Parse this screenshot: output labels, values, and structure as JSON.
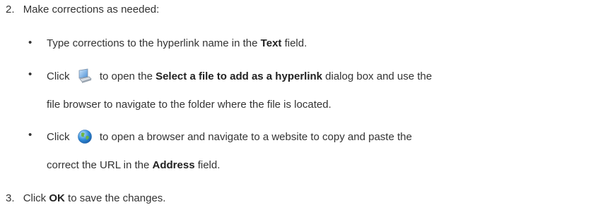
{
  "step2": {
    "number": "2.",
    "text": "Make corrections as needed:"
  },
  "bullets": [
    {
      "pre": "Type corrections to the hyperlink name in the ",
      "bold": "Text",
      "post": " field."
    },
    {
      "pre": "Click",
      "icon": "computer-icon",
      "mid": "to open the ",
      "bold": "Select a file to add as a hyperlink",
      "post": " dialog box and use the",
      "cont": "file browser to navigate to the folder where the file is located."
    },
    {
      "pre": "Click",
      "icon": "globe-icon",
      "mid": "to open a browser and navigate to a website to copy and paste the",
      "cont_pre": "correct the URL in the ",
      "cont_bold": "Address",
      "cont_post": " field."
    }
  ],
  "step3": {
    "number": "3.",
    "pre": "Click ",
    "bold": "OK",
    "post": " to save the changes."
  },
  "bullet_char": "•"
}
